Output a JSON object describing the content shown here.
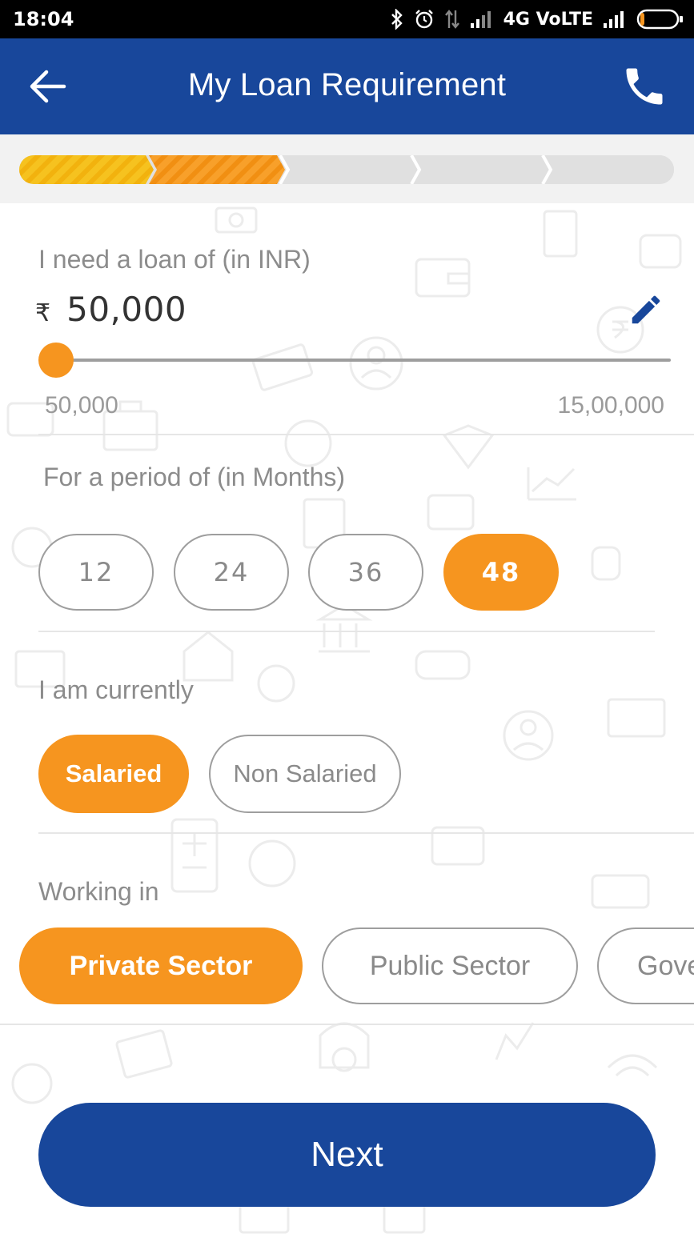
{
  "status_bar": {
    "time": "18:04",
    "network": "4G VoLTE"
  },
  "app_bar": {
    "title": "My Loan Requirement",
    "back_icon": "arrow-left-icon",
    "call_icon": "phone-icon",
    "color": "#18479b"
  },
  "progress": {
    "total_steps": 5,
    "completed_steps": 2,
    "colors": [
      "#f6c21f",
      "#f6951f",
      "#e0e0e0"
    ]
  },
  "loan": {
    "label": "I need a loan of (in INR)",
    "currency_symbol": "₹",
    "amount": "50,000",
    "edit_icon": "pencil-icon",
    "min_label": "50,000",
    "max_label": "15,00,000",
    "slider_fraction": 0
  },
  "period": {
    "label": "For a period of (in Months)",
    "options": [
      "12",
      "24",
      "36",
      "48"
    ],
    "selected": "48"
  },
  "employment": {
    "label": "I am currently",
    "options": [
      "Salaried",
      "Non Salaried"
    ],
    "selected": "Salaried"
  },
  "sector": {
    "label": "Working in",
    "options": [
      "Private Sector",
      "Public Sector",
      "Gove"
    ],
    "selected": "Private Sector"
  },
  "next_button": "Next",
  "accent_color": "#f6951f"
}
